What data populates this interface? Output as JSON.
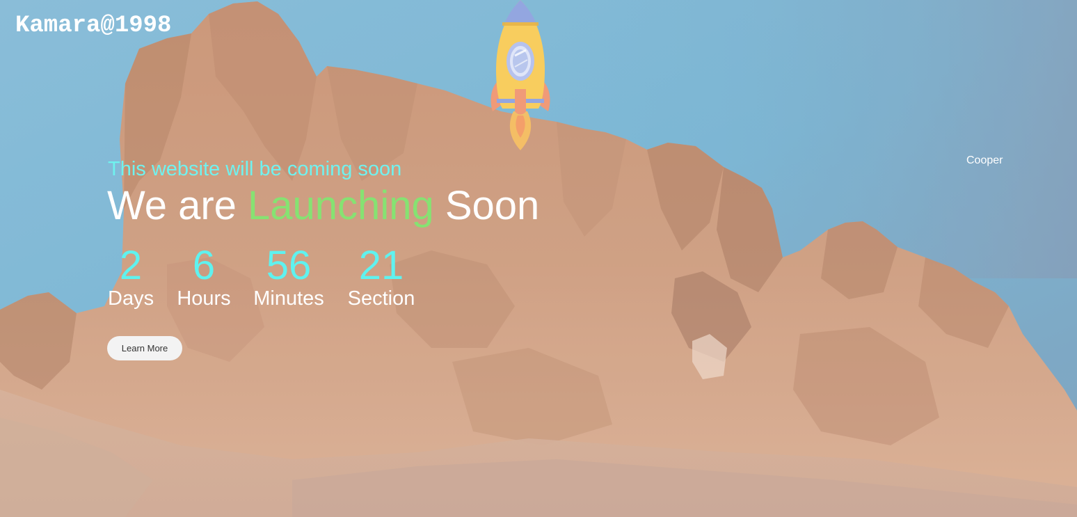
{
  "brand": {
    "text": "Kamara@1998"
  },
  "corner_name": "Cooper",
  "hero": {
    "subtitle": "This website will be coming soon",
    "headline_prefix": "We are",
    "headline_accent": "Launching",
    "headline_suffix": "Soon"
  },
  "countdown": {
    "days": {
      "value": "2",
      "label": "Days"
    },
    "hours": {
      "value": "6",
      "label": "Hours"
    },
    "minutes": {
      "value": "56",
      "label": "Minutes"
    },
    "seconds": {
      "value": "21",
      "label": "Section"
    }
  },
  "cta": {
    "learn_more_label": "Learn More"
  },
  "colors": {
    "subtitle": "#6ff2ef",
    "accent": "#86e272",
    "countdown_number": "#5ff2ef",
    "sky": "#6aa8c9",
    "rock": "#c99270"
  },
  "icons": {
    "rocket": "rocket-icon"
  }
}
